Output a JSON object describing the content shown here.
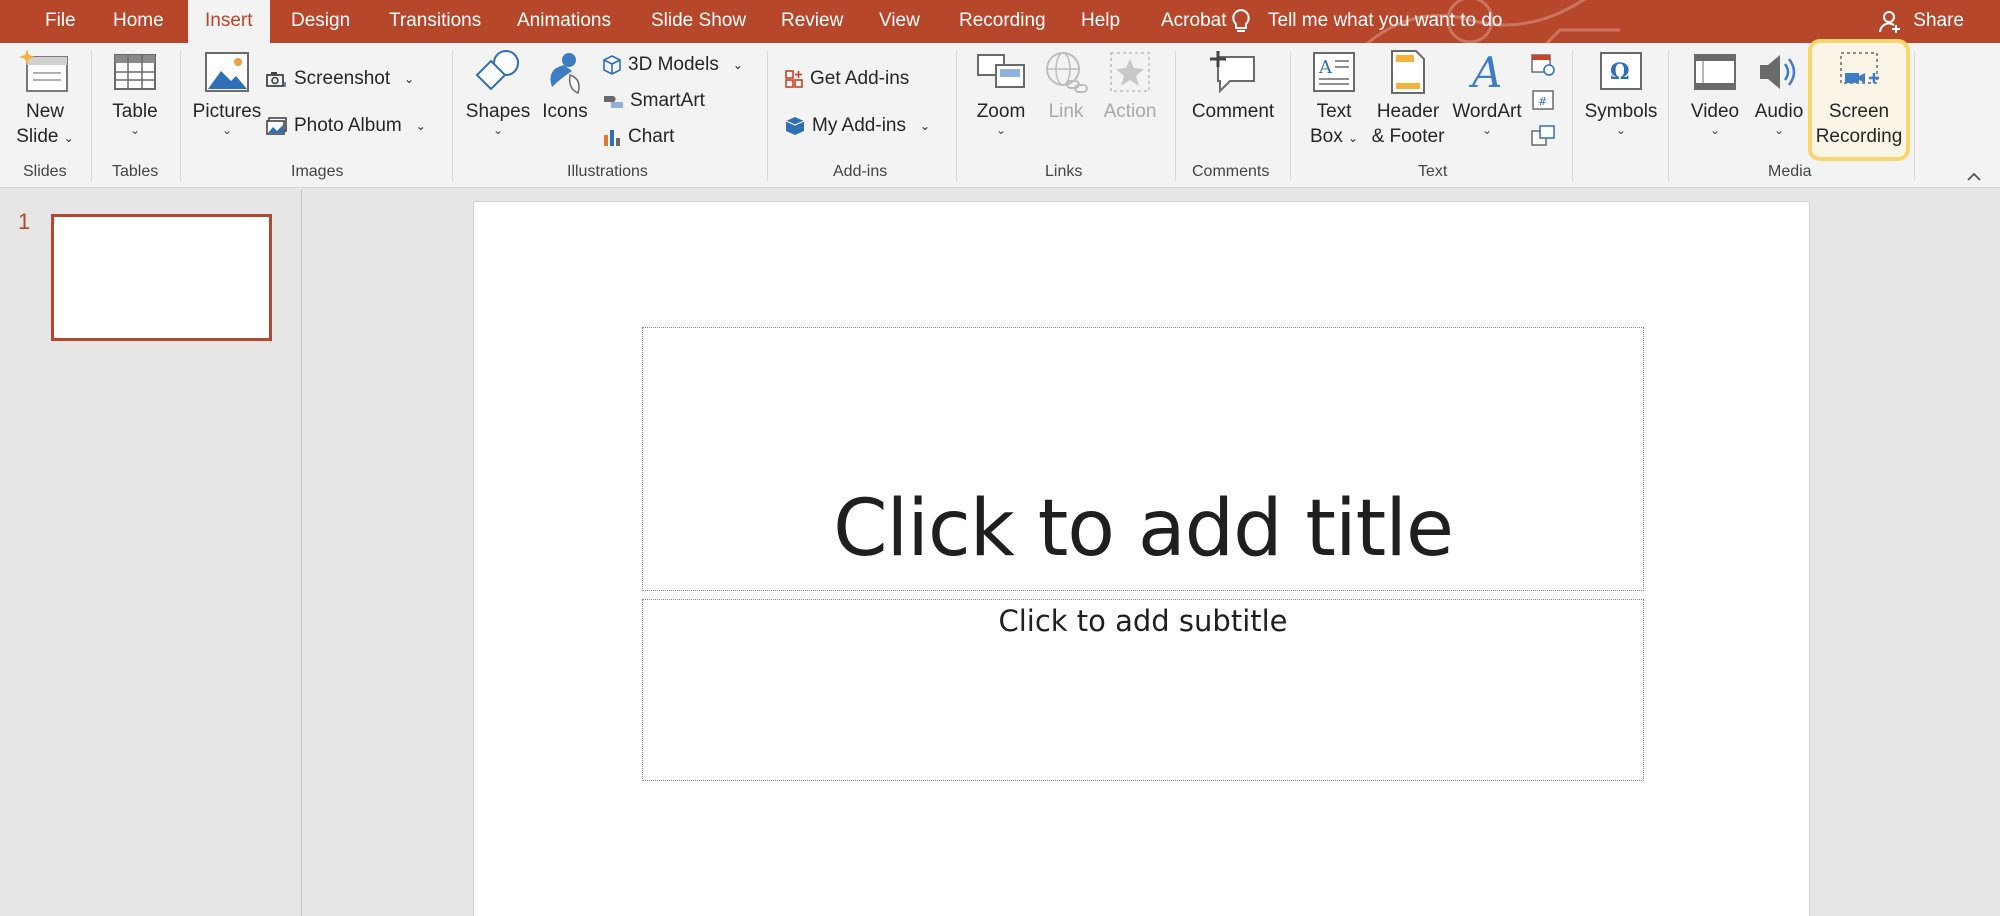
{
  "menu": {
    "tabs": [
      {
        "label": "File"
      },
      {
        "label": "Home"
      },
      {
        "label": "Insert",
        "active": true
      },
      {
        "label": "Design"
      },
      {
        "label": "Transitions"
      },
      {
        "label": "Animations"
      },
      {
        "label": "Slide Show"
      },
      {
        "label": "Review"
      },
      {
        "label": "View"
      },
      {
        "label": "Recording"
      },
      {
        "label": "Help"
      },
      {
        "label": "Acrobat"
      }
    ],
    "tell_me": "Tell me what you want to do",
    "share": "Share"
  },
  "ribbon": {
    "slides": {
      "new_slide_1": "New",
      "new_slide_2": "Slide",
      "group": "Slides"
    },
    "tables": {
      "table": "Table",
      "group": "Tables"
    },
    "images": {
      "pictures": "Pictures",
      "screenshot": "Screenshot",
      "photo_album": "Photo Album",
      "group": "Images"
    },
    "illustrations": {
      "shapes": "Shapes",
      "icons": "Icons",
      "models_3d": "3D Models",
      "smartart": "SmartArt",
      "chart": "Chart",
      "group": "Illustrations"
    },
    "addins": {
      "get_addins": "Get Add-ins",
      "my_addins": "My Add-ins",
      "group": "Add-ins"
    },
    "links": {
      "zoom": "Zoom",
      "link": "Link",
      "action": "Action",
      "group": "Links"
    },
    "comments": {
      "comment": "Comment",
      "group": "Comments"
    },
    "text": {
      "textbox_1": "Text",
      "textbox_2": "Box",
      "header_1": "Header",
      "header_2": "& Footer",
      "wordart": "WordArt",
      "group": "Text"
    },
    "symbols": {
      "symbols": "Symbols"
    },
    "media": {
      "video": "Video",
      "audio": "Audio",
      "screen_rec_1": "Screen",
      "screen_rec_2": "Recording",
      "group": "Media"
    }
  },
  "thumbnails": {
    "slide_number": "1"
  },
  "slide": {
    "title_placeholder": "Click to add title",
    "subtitle_placeholder": "Click to add subtitle"
  },
  "colors": {
    "accent": "#b7472a",
    "highlight": "#f9d56e"
  }
}
